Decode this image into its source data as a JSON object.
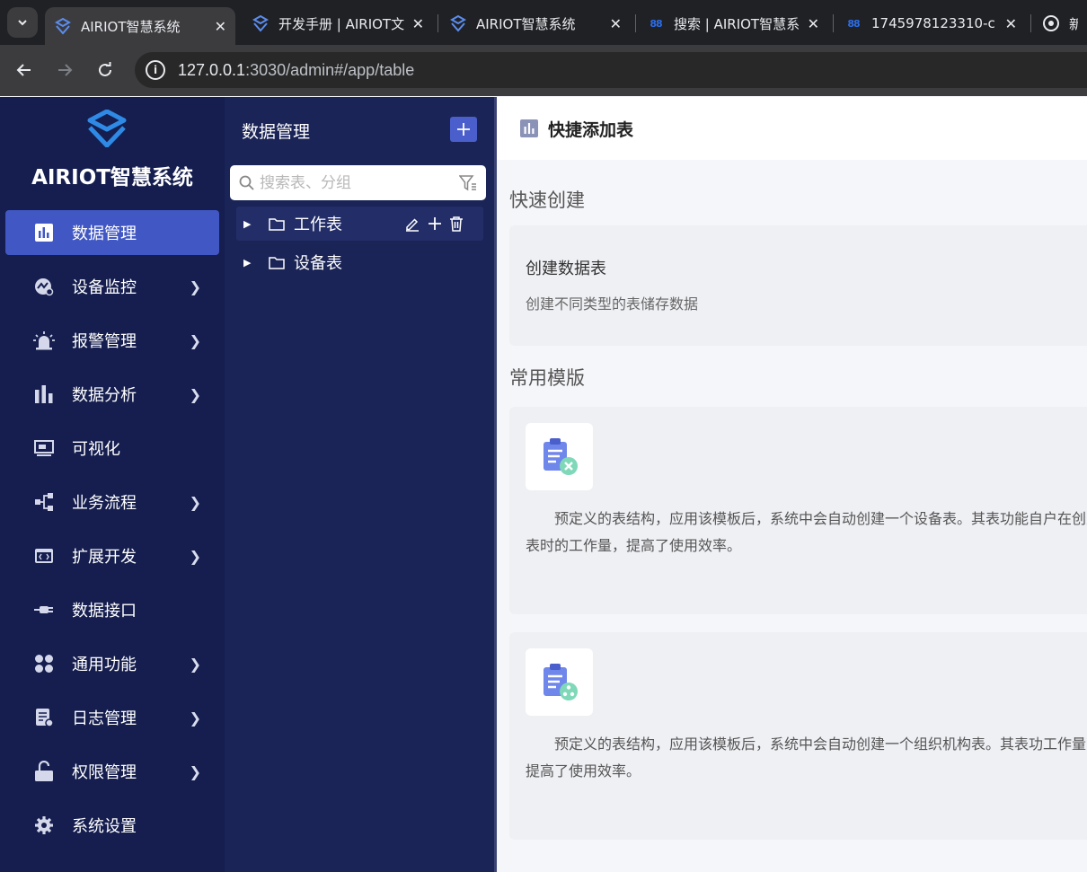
{
  "browser": {
    "tabs": [
      {
        "label": "AIRIOT智慧系统",
        "active": true,
        "favicon": "airiot-logo-icon"
      },
      {
        "label": "开发手册 | AIRIOT文",
        "active": false,
        "favicon": "airiot-logo-icon"
      },
      {
        "label": "AIRIOT智慧系统",
        "active": false,
        "favicon": "airiot-logo-icon"
      },
      {
        "label": "搜索 | AIRIOT智慧系",
        "active": false,
        "favicon": "88-icon"
      },
      {
        "label": "1745978123310-c",
        "active": false,
        "favicon": "88-icon"
      },
      {
        "label": "新标",
        "active": false,
        "favicon": "chrome-icon"
      }
    ],
    "url_host": "127.0.0.1",
    "url_rest": ":3030/admin#/app/table"
  },
  "sidebar": {
    "brand": "AIRIOT智慧系统",
    "items": [
      {
        "label": "数据管理",
        "icon": "bar-chart-icon",
        "active": true,
        "has_children": false
      },
      {
        "label": "设备监控",
        "icon": "device-monitor-icon",
        "active": false,
        "has_children": true
      },
      {
        "label": "报警管理",
        "icon": "alarm-icon",
        "active": false,
        "has_children": true
      },
      {
        "label": "数据分析",
        "icon": "analytics-icon",
        "active": false,
        "has_children": true
      },
      {
        "label": "可视化",
        "icon": "monitor-icon",
        "active": false,
        "has_children": false
      },
      {
        "label": "业务流程",
        "icon": "workflow-icon",
        "active": false,
        "has_children": true
      },
      {
        "label": "扩展开发",
        "icon": "code-window-icon",
        "active": false,
        "has_children": true
      },
      {
        "label": "数据接口",
        "icon": "plug-icon",
        "active": false,
        "has_children": false
      },
      {
        "label": "通用功能",
        "icon": "apps-icon",
        "active": false,
        "has_children": true
      },
      {
        "label": "日志管理",
        "icon": "log-icon",
        "active": false,
        "has_children": true
      },
      {
        "label": "权限管理",
        "icon": "lock-icon",
        "active": false,
        "has_children": true
      },
      {
        "label": "系统设置",
        "icon": "gear-icon",
        "active": false,
        "has_children": false
      }
    ]
  },
  "tree": {
    "title": "数据管理",
    "search_placeholder": "搜索表、分组",
    "nodes": [
      {
        "label": "工作表"
      },
      {
        "label": "设备表"
      }
    ]
  },
  "main": {
    "header_title": "快捷添加表",
    "quick_create_title": "快速创建",
    "create_card": {
      "title": "创建数据表",
      "desc": "创建不同类型的表储存数据"
    },
    "templates_title": "常用模版",
    "templates": [
      {
        "text": "预定义的表结构，应用该模板后，系统中会自动创建一个设备表。其表功能自户在创建表时的工作量，提高了使用效率。",
        "icon": "device-table-template-icon"
      },
      {
        "text": "预定义的表结构，应用该模板后，系统中会自动创建一个组织机构表。其表功工作量，提高了使用效率。",
        "icon": "org-table-template-icon"
      }
    ]
  },
  "colors": {
    "sidebar_bg": "#151e4f",
    "tree_bg": "#1b2456",
    "active_item": "#4158c4",
    "accent": "#4a5fcc"
  }
}
